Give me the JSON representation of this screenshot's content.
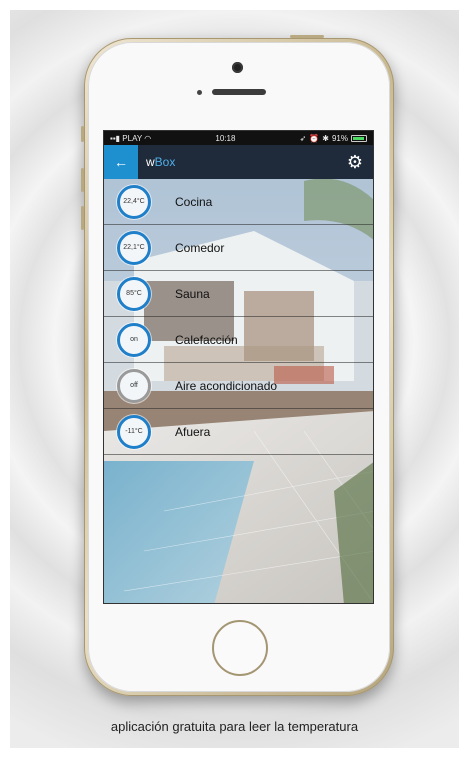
{
  "status_bar": {
    "carrier": "PLAY",
    "time": "10:18",
    "battery": "91%"
  },
  "app": {
    "title_prefix": "w",
    "title_accent": "Box",
    "back_icon": "back-arrow-icon",
    "settings_icon": "gear-icon"
  },
  "rooms": [
    {
      "value": "22,4°C",
      "label": "Cocina",
      "state": "on"
    },
    {
      "value": "22,1°C",
      "label": "Comedor",
      "state": "on"
    },
    {
      "value": "85°C",
      "label": "Sauna",
      "state": "on"
    },
    {
      "value": "on",
      "label": "Calefacción",
      "state": "on"
    },
    {
      "value": "off",
      "label": "Aire acondicionado",
      "state": "off"
    },
    {
      "value": "-11°C",
      "label": "Afuera",
      "state": "on"
    }
  ],
  "caption": "aplicación gratuita para leer la temperatura",
  "colors": {
    "accent": "#1e90d0",
    "navbar": "#1f2a3a",
    "gauge_on": "#1f7fc9",
    "gauge_off": "#9a9a9a"
  }
}
